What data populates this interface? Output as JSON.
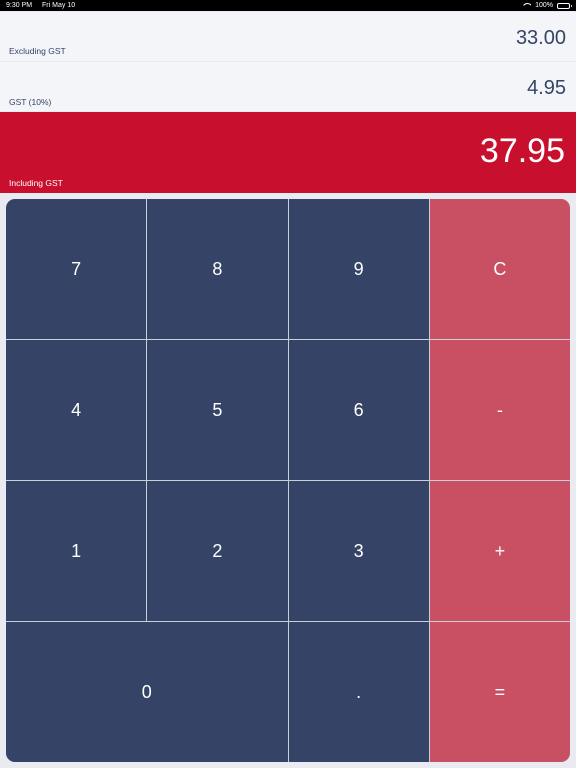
{
  "status_bar": {
    "time": "9:30 PM",
    "date": "Fri May 10",
    "battery": "100%"
  },
  "excluding": {
    "value": "33.00",
    "label": "Excluding GST"
  },
  "gst": {
    "value": "4.95",
    "label": "GST (10%)"
  },
  "including": {
    "value": "37.95",
    "label": "Including GST"
  },
  "keys": {
    "k7": "7",
    "k8": "8",
    "k9": "9",
    "clear": "C",
    "k4": "4",
    "k5": "5",
    "k6": "6",
    "minus": "-",
    "k1": "1",
    "k2": "2",
    "k3": "3",
    "plus": "+",
    "k0": "0",
    "dot": ".",
    "equals": "="
  },
  "colors": {
    "navy": "#354466",
    "red": "#c8102e",
    "operator": "#c94f63",
    "background": "#f3f5f9"
  },
  "icons": [
    "wifi-icon",
    "battery-icon"
  ]
}
